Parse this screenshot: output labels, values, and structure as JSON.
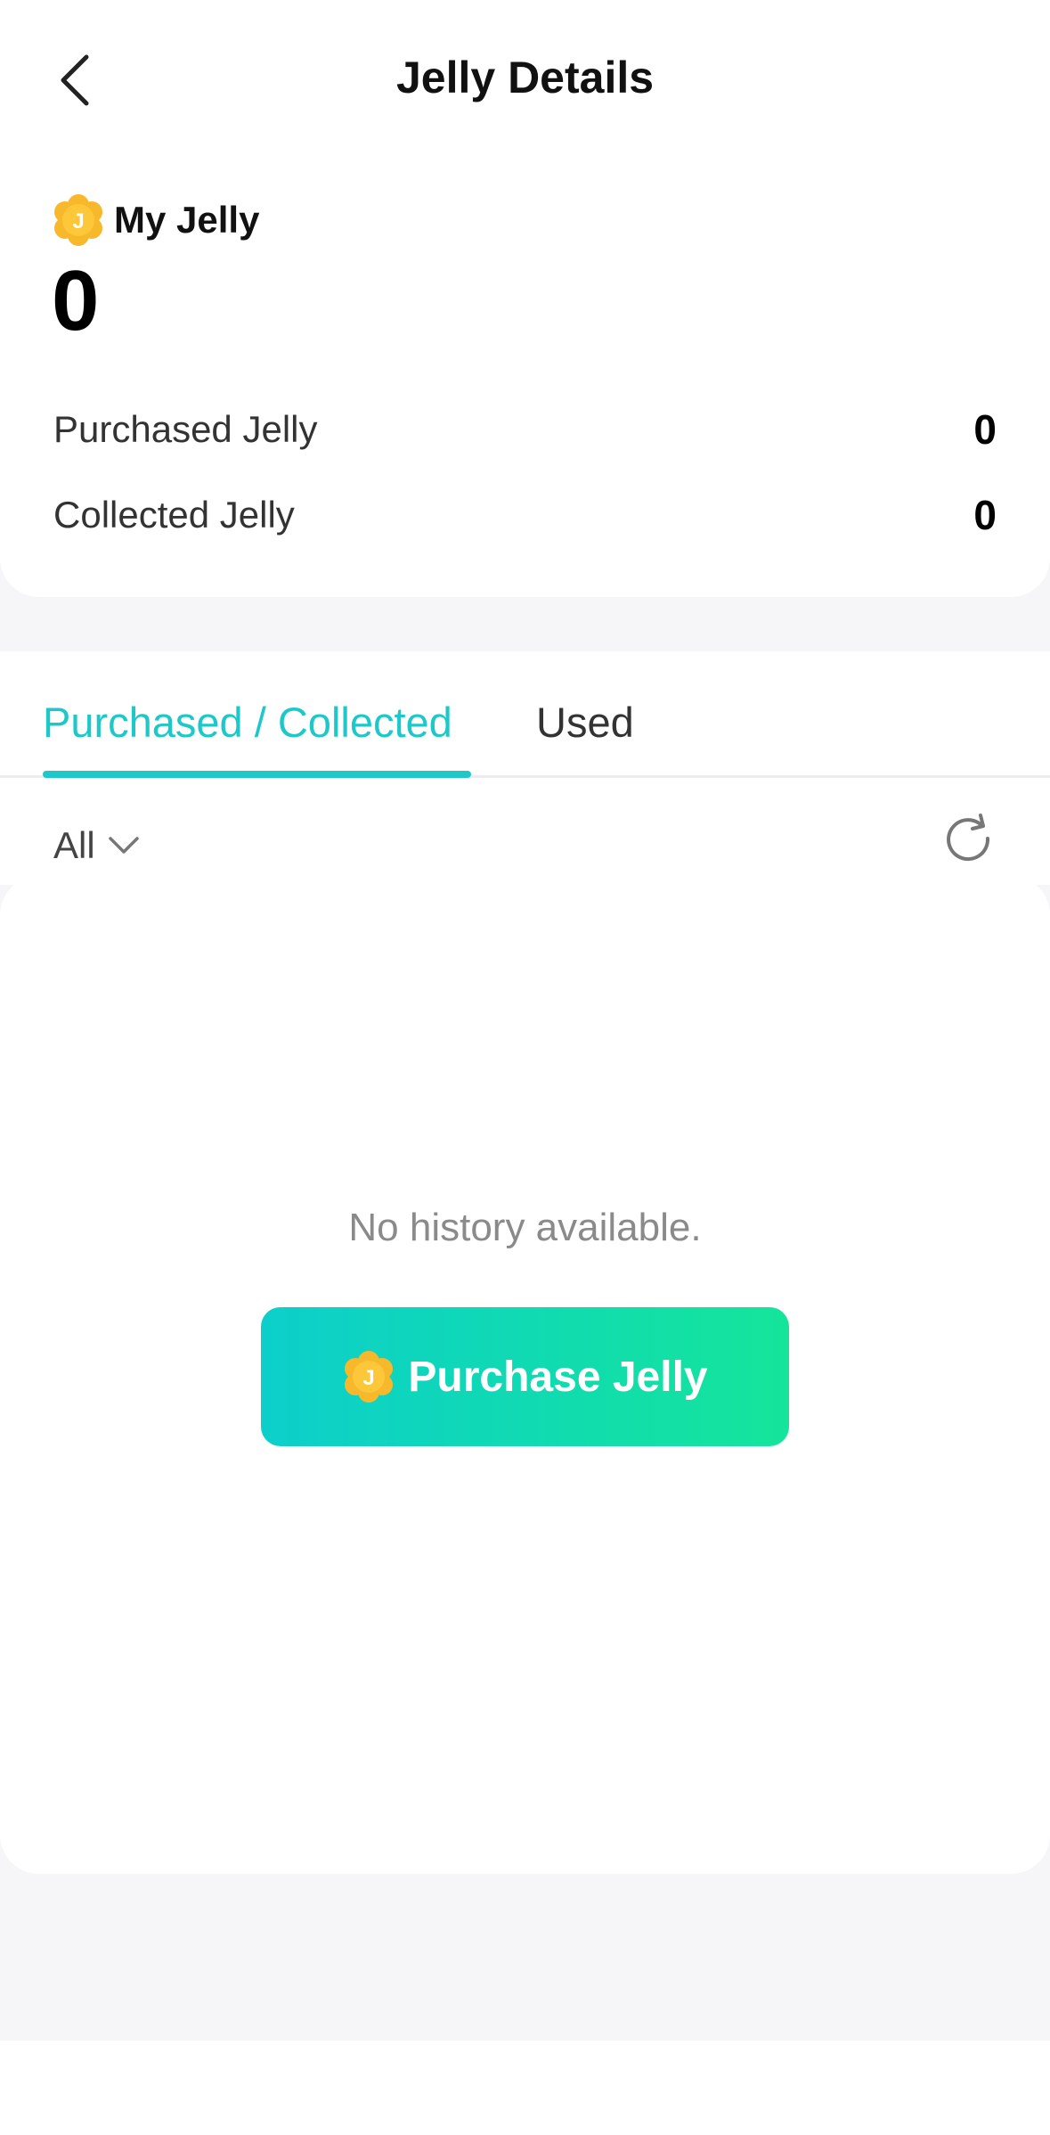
{
  "header": {
    "title": "Jelly Details",
    "back_icon": "chevron-left-icon"
  },
  "summary": {
    "my_jelly_label": "My Jelly",
    "my_jelly_value": "0",
    "coin_letter": "J",
    "purchased_label": "Purchased Jelly",
    "purchased_value": "0",
    "collected_label": "Collected Jelly",
    "collected_value": "0"
  },
  "tabs": [
    {
      "label": "Purchased / Collected",
      "active": true
    },
    {
      "label": "Used",
      "active": false
    }
  ],
  "filter": {
    "selected": "All",
    "refresh_icon": "refresh-icon"
  },
  "history": {
    "empty_text": "No history available.",
    "purchase_button_label": "Purchase Jelly"
  },
  "colors": {
    "accent": "#1ec8c8",
    "button_gradient_start": "#0ccfcb",
    "button_gradient_end": "#14e59a",
    "coin": "#f7b82b"
  }
}
